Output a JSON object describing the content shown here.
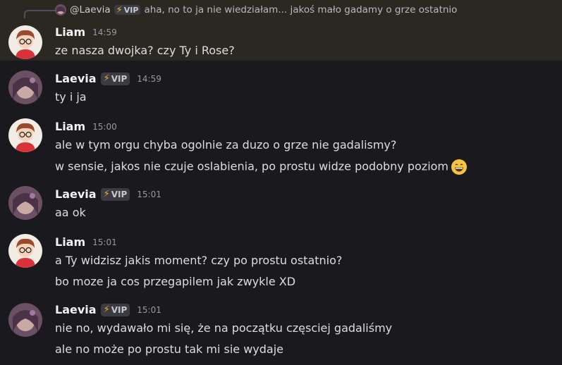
{
  "reply": {
    "author": "@Laevia",
    "badge": "VIP",
    "text": "aha, no to ja nie wiedziałam... jakoś mało gadamy o grze ostatnio"
  },
  "messages": [
    {
      "author": "Liam",
      "badge": "",
      "time": "14:59",
      "lines": [
        "ze nasza dwojka? czy Ty i Rose?"
      ]
    },
    {
      "author": "Laevia",
      "badge": "VIP",
      "time": "14:59",
      "lines": [
        "ty i ja"
      ]
    },
    {
      "author": "Liam",
      "badge": "",
      "time": "15:00",
      "lines": [
        "ale w tym orgu chyba ogolnie za duzo o grze nie gadalismy?",
        "w sensie, jakos nie czuje oslabienia, po prostu widze podobny poziom"
      ]
    },
    {
      "author": "Laevia",
      "badge": "VIP",
      "time": "15:01",
      "lines": [
        "aa ok"
      ]
    },
    {
      "author": "Liam",
      "badge": "",
      "time": "15:01",
      "lines": [
        "a Ty widzisz jakis moment? czy po prostu ostatnio?",
        "bo moze ja cos przegapilem jak zwykle XD"
      ]
    },
    {
      "author": "Laevia",
      "badge": "VIP",
      "time": "15:01",
      "lines": [
        "nie no, wydawało mi się, że na początku częsciej gadaliśmy",
        "ale no może po prostu tak mi sie wydaje"
      ]
    }
  ],
  "emoji": "grinning-face-with-smiling-eyes-icon",
  "colors": {
    "background": "#1a1a1e",
    "highlight": "#2b2821",
    "badge_bolt": "#f0b232"
  }
}
